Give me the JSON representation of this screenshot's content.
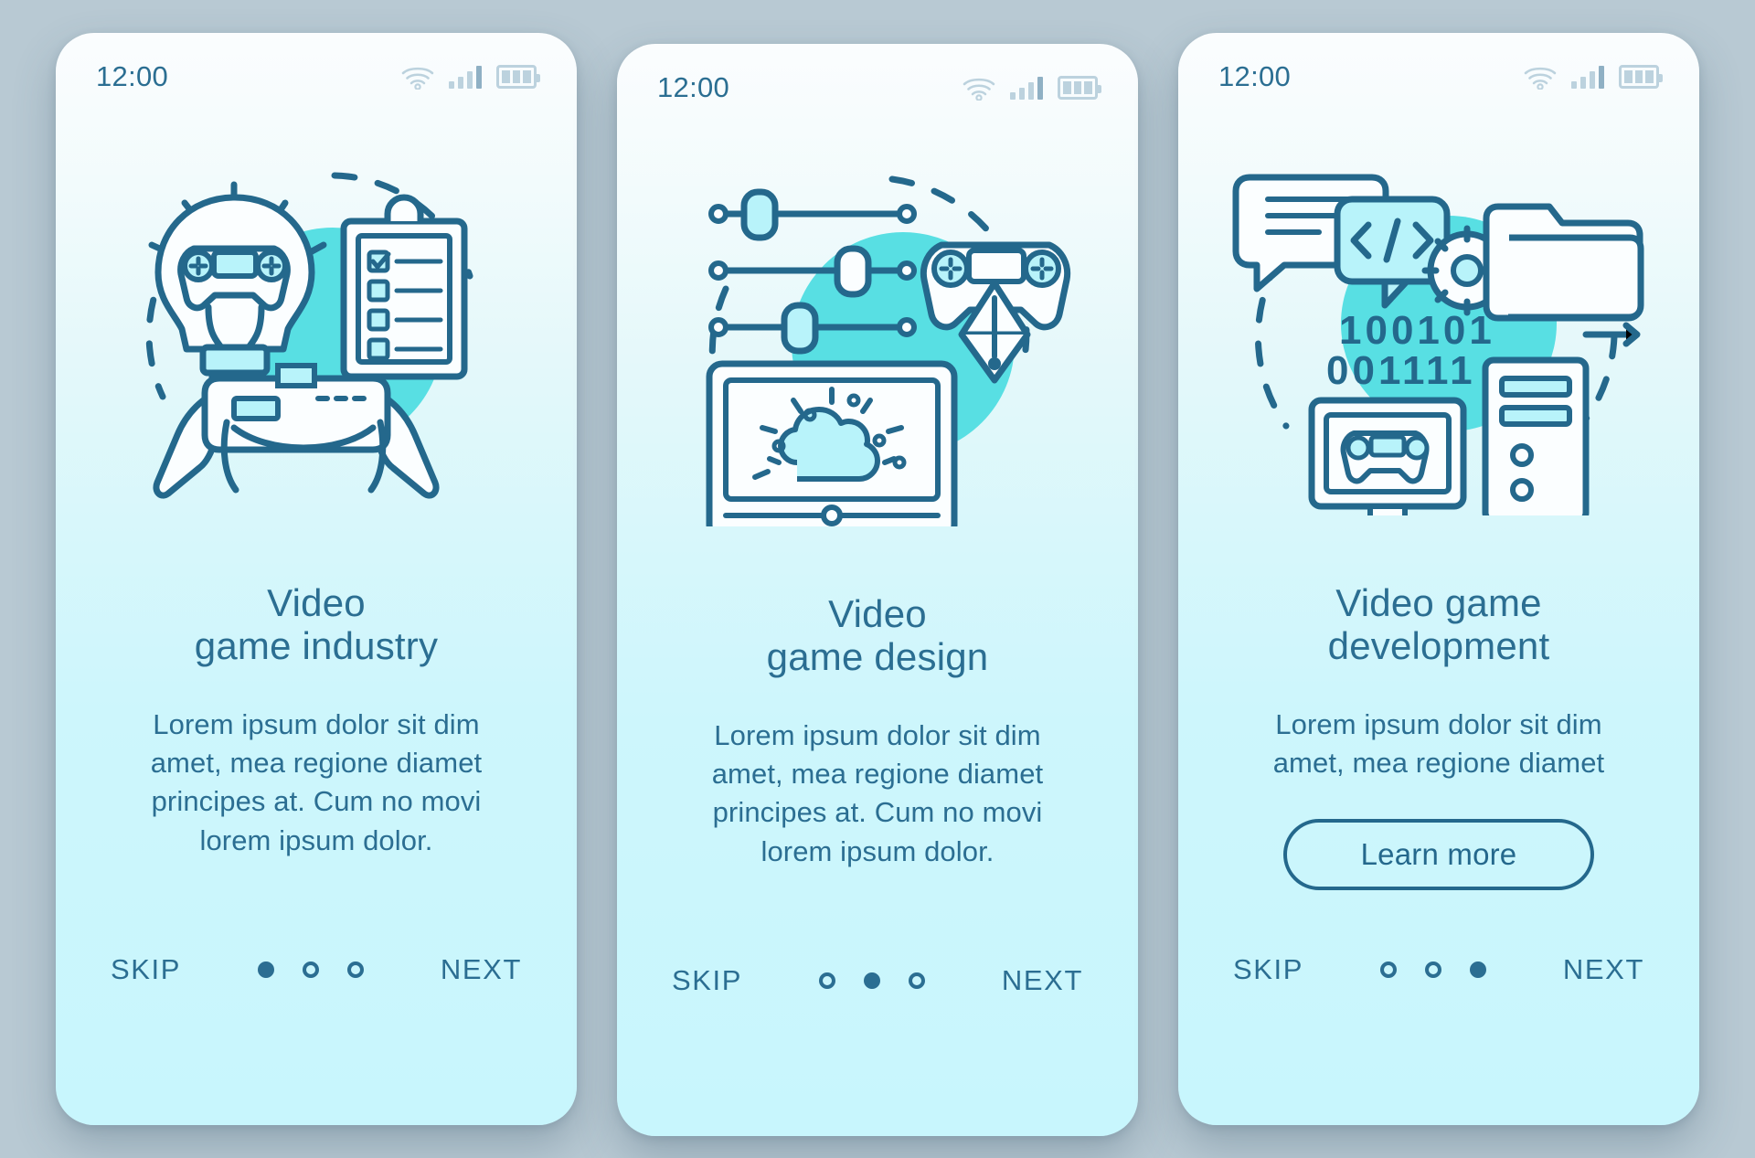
{
  "background_color": "#b8c9d3",
  "accent_color": "#2b6e92",
  "screens": [
    {
      "status": {
        "time": "12:00",
        "wifi_icon": "wifi-icon",
        "signal_icon": "signal-bars-icon",
        "battery_icon": "battery-icon"
      },
      "illustration": "video-game-industry-illustration",
      "title": "Video\ngame industry",
      "description": "Lorem ipsum dolor sit dim\namet, mea regione diamet\nprincipes at. Cum no movi\nlorem ipsum dolor.",
      "has_button": false,
      "button_label": "",
      "skip_label": "SKIP",
      "next_label": "NEXT",
      "dots": [
        true,
        false,
        false
      ]
    },
    {
      "status": {
        "time": "12:00",
        "wifi_icon": "wifi-icon",
        "signal_icon": "signal-bars-icon",
        "battery_icon": "battery-icon"
      },
      "illustration": "video-game-design-illustration",
      "title": "Video\ngame design",
      "description": "Lorem ipsum dolor sit dim\namet, mea regione diamet\nprincipes at. Cum no movi\nlorem ipsum dolor.",
      "has_button": false,
      "button_label": "",
      "skip_label": "SKIP",
      "next_label": "NEXT",
      "dots": [
        false,
        true,
        false
      ]
    },
    {
      "status": {
        "time": "12:00",
        "wifi_icon": "wifi-icon",
        "signal_icon": "signal-bars-icon",
        "battery_icon": "battery-icon"
      },
      "illustration": "video-game-development-illustration",
      "title": "Video game\ndevelopment",
      "description": "Lorem ipsum dolor sit dim\namet, mea regione diamet",
      "has_button": true,
      "button_label": "Learn more",
      "skip_label": "SKIP",
      "next_label": "NEXT",
      "dots": [
        false,
        false,
        true
      ],
      "binary_text": {
        "line1": "100101",
        "line2": "001111"
      }
    }
  ]
}
